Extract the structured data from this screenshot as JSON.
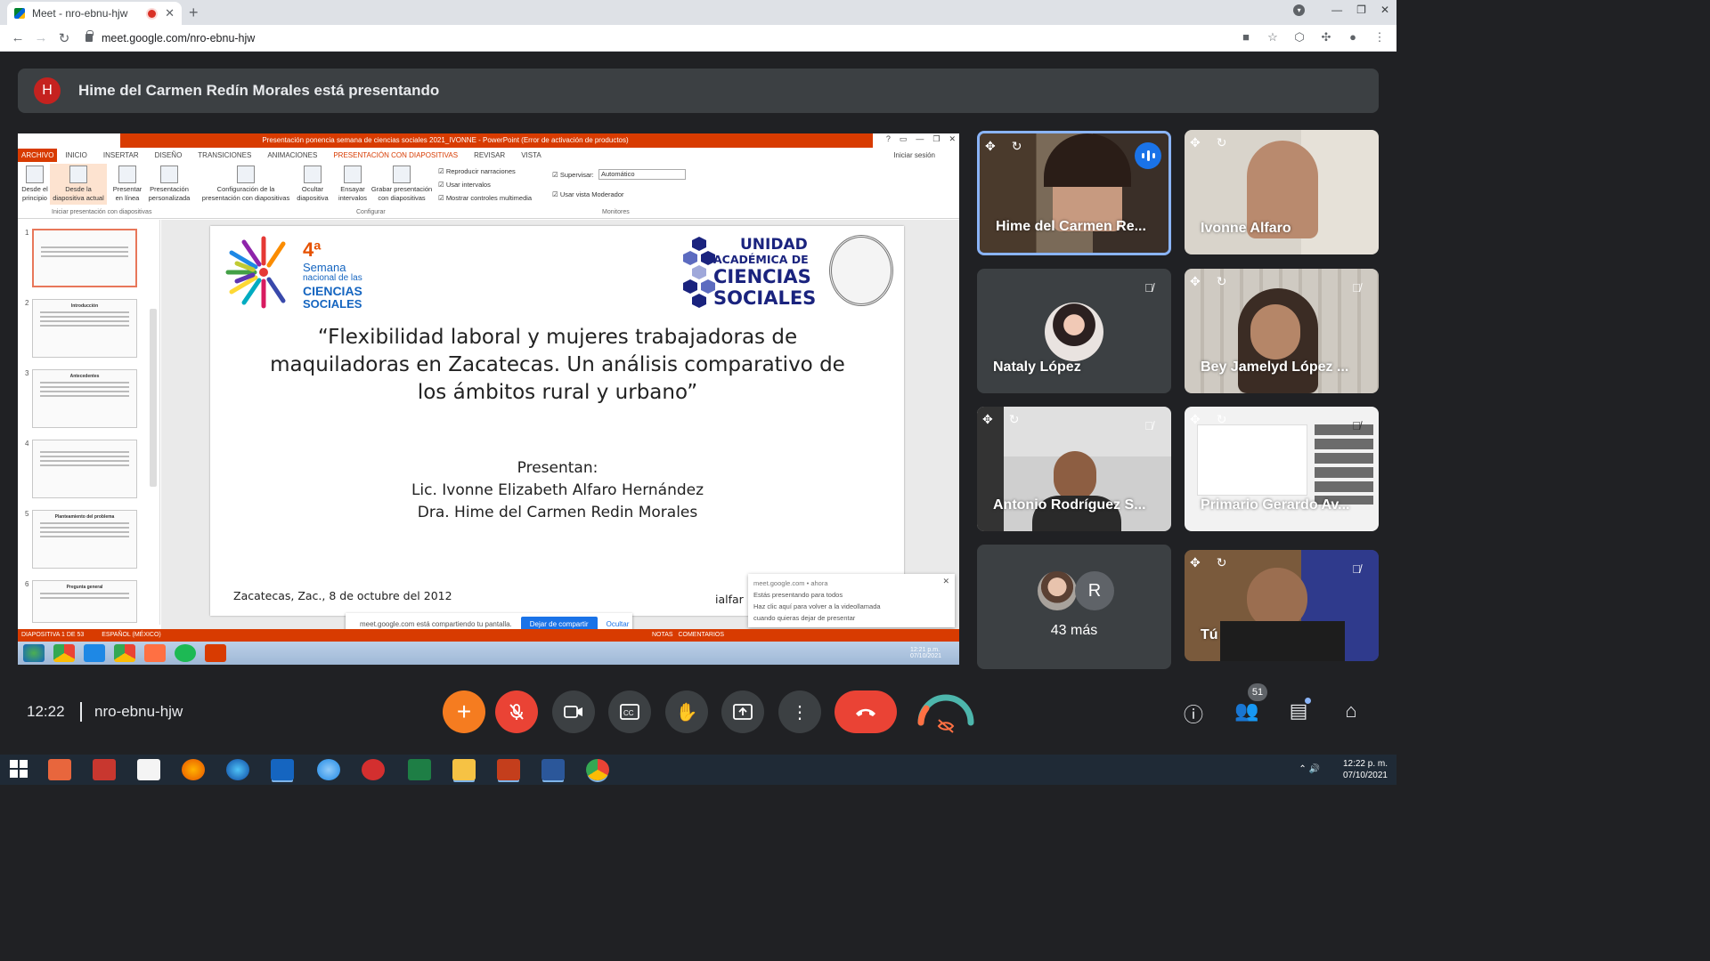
{
  "browser": {
    "tab_title": "Meet - nro-ebnu-hjw",
    "url": "meet.google.com/nro-ebnu-hjw"
  },
  "banner": {
    "avatar_letter": "H",
    "text": "Hime del Carmen Redín Morales está presentando"
  },
  "powerpoint": {
    "window_title": "Presentación ponencia semana de ciencias sociales 2021_IVONNE - PowerPoint (Error de activación de productos)",
    "menu": [
      "ARCHIVO",
      "INICIO",
      "INSERTAR",
      "DISEÑO",
      "TRANSICIONES",
      "ANIMACIONES",
      "PRESENTACIÓN CON DIAPOSITIVAS",
      "REVISAR",
      "VISTA"
    ],
    "sign_in": "Iniciar sesión",
    "ribbon": {
      "btn1": "Desde el principio",
      "btn2": "Desde la diapositiva actual",
      "btn3": "Presentar en línea",
      "btn4": "Presentación personalizada",
      "btn5": "Configuración de la presentación con diapositivas",
      "btn6": "Ocultar diapositiva",
      "btn7": "Ensayar intervalos",
      "btn8": "Grabar presentación con diapositivas",
      "chk1": "Reproducir narraciones",
      "chk2": "Usar intervalos",
      "chk3": "Mostrar controles multimedia",
      "monitor_label": "Supervisar:",
      "monitor_value": "Automático",
      "chk4": "Usar vista Moderador",
      "group1": "Iniciar presentación con diapositivas",
      "group2": "Configurar",
      "group3": "Monitores"
    },
    "thumbnails": [
      {
        "num": "1",
        "title": ""
      },
      {
        "num": "2",
        "title": "Introducción"
      },
      {
        "num": "3",
        "title": "Antecedentes"
      },
      {
        "num": "4",
        "title": ""
      },
      {
        "num": "5",
        "title": "Planteamiento del problema"
      },
      {
        "num": "6",
        "title": "Pregunta general"
      }
    ],
    "slide": {
      "logo_left_num": "4ª",
      "logo_left_l1": "Semana",
      "logo_left_l2": "nacional de las",
      "logo_left_l3": "CIENCIAS",
      "logo_left_l4": "SOCIALES",
      "logo_right_l1": "UNIDAD",
      "logo_right_l2": "ACADÉMICA DE",
      "logo_right_l3": "CIENCIAS",
      "logo_right_l4": "SOCIALES",
      "title": "“Flexibilidad laboral y mujeres trabajadoras de maquiladoras en Zacatecas. Un análisis comparativo de los ámbitos rural y urbano”",
      "presentan": "Presentan:",
      "author1": "Lic. Ivonne Elizabeth Alfaro Hernández",
      "author2": "Dra. Hime del Carmen Redin Morales",
      "date": "Zacatecas, Zac., 8 de octubre del 2012",
      "author_short": "ialfar"
    },
    "notification": {
      "source": "meet.google.com • ahora",
      "line1": "Estás presentando para todos",
      "line2": "Haz clic aquí para volver a la videollamada",
      "line3": "cuando quieras dejar de presentar"
    },
    "share_bar": {
      "text": "meet.google.com está compartiendo tu pantalla.",
      "stop": "Dejar de compartir",
      "hide": "Ocultar"
    },
    "status_left": "DIAPOSITIVA 1 DE 53",
    "status_lang": "ESPAÑOL (MÉXICO)",
    "status_notes": "NOTAS",
    "status_comments": "COMENTARIOS",
    "taskbar_time": "12:21 p.m.",
    "taskbar_date": "07/10/2021"
  },
  "participants": [
    {
      "name": "Hime del Carmen Re...",
      "speaking": true
    },
    {
      "name": "Ivonne Alfaro",
      "muted": false
    },
    {
      "name": "Nataly López",
      "muted": true
    },
    {
      "name": "Bey Jamelyd López ...",
      "muted": true
    },
    {
      "name": "Antonio Rodríguez S...",
      "muted": true
    },
    {
      "name": "Primario Gerardo Av...",
      "muted": true
    },
    {
      "name": "43 más",
      "avatar_letter": "R"
    },
    {
      "name": "Tú",
      "muted": true
    }
  ],
  "controls": {
    "time": "12:22",
    "meeting_code": "nro-ebnu-hjw",
    "people_count": "51"
  },
  "windows": {
    "time": "12:22 p. m.",
    "date": "07/10/2021"
  },
  "colors": {
    "meet_bg": "#202124",
    "tile_bg": "#3c4043",
    "end_call": "#ea4335",
    "powerpoint_accent": "#d83b01",
    "active_speaker": "#8ab4f8"
  }
}
